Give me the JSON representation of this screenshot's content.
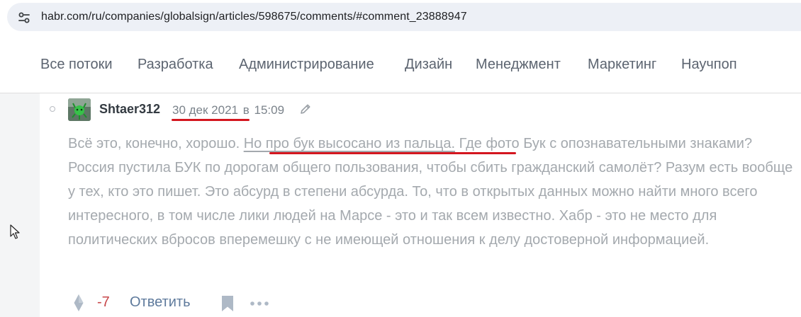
{
  "browser": {
    "url": "habr.com/ru/companies/globalsign/articles/598675/comments/#comment_23888947",
    "site_info_icon": "tune-icon"
  },
  "nav": {
    "items": [
      {
        "label": "Все потоки"
      },
      {
        "label": "Разработка"
      },
      {
        "label": "Администрирование"
      },
      {
        "label": "Дизайн"
      },
      {
        "label": "Менеджмент"
      },
      {
        "label": "Маркетинг"
      },
      {
        "label": "Научпоп"
      }
    ]
  },
  "comment": {
    "author": "Shtaer312",
    "date": "30 дек 2021",
    "time_sep": "в",
    "time": "15:09",
    "body_prefix": "Всё это, конечно, хорошо. ",
    "body_highlight": "Но про бук высосано из пальца.",
    "body_suffix": " Где фото Бук с опознавательными знаками? Россия пустила БУК по дорогам общего пользования, чтобы сбить гражданский самолёт? Разум есть вообще у тех, кто это пишет. Это абсурд в степени абсурда. То, что в открытых данных можно найти много всего интересного, в том числе лики людей на Марсе - это и так всем известно. Хабр - это не место для политических вбросов вперемешку с не имеющей отношения к делу достоверной информацией.",
    "score": "-7",
    "reply_label": "Ответить"
  },
  "colors": {
    "annotation_red": "#d4161f",
    "score_negative": "#c7474a",
    "link_blue": "#5e7a9c"
  }
}
